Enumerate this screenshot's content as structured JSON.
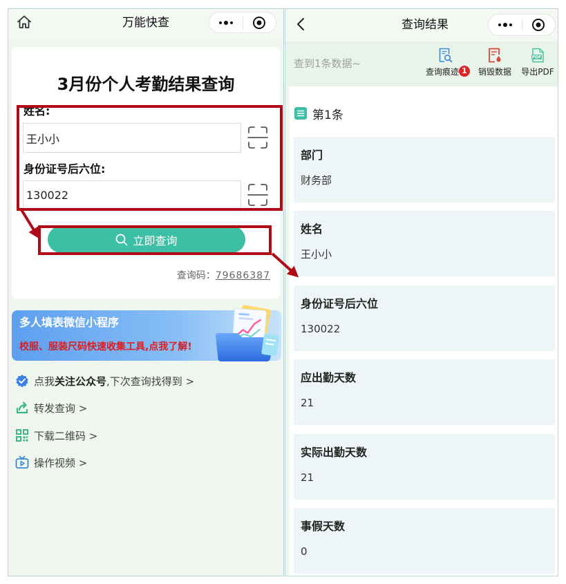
{
  "left_screen": {
    "header": {
      "title": "万能快查"
    },
    "form": {
      "title": "3月份个人考勤结果查询",
      "fields": [
        {
          "label": "姓名:",
          "value": "王小小"
        },
        {
          "label": "身份证号后六位:",
          "value": "130022"
        }
      ],
      "submit_label": "立即查询",
      "query_code_label": "查询码：",
      "query_code": "79686387"
    },
    "banner": {
      "title": "多人填表微信小程序",
      "subtitle": "校服、服装尺码快速收集工具,点我了解!"
    },
    "links": {
      "follow_prefix": "点我",
      "follow_bold": "关注公众号",
      "follow_suffix": ",下次查询找得到 >",
      "forward": "转发查询 >",
      "download_qr": "下载二维码 >",
      "video": "操作视频 >"
    }
  },
  "right_screen": {
    "header": {
      "title": "查询结果"
    },
    "summary": "查到1条数据~",
    "toolbar": [
      {
        "label": "查询痕迹",
        "icon": "search-history-icon",
        "badge": "1"
      },
      {
        "label": "销毁数据",
        "icon": "destroy-data-icon"
      },
      {
        "label": "导出PDF",
        "icon": "export-pdf-icon",
        "icon_text": "PDF"
      }
    ],
    "record": {
      "title": "第1条",
      "fields": [
        {
          "label": "部门",
          "value": "财务部"
        },
        {
          "label": "姓名",
          "value": "王小小"
        },
        {
          "label": "身份证号后六位",
          "value": "130022"
        },
        {
          "label": "应出勤天数",
          "value": "21"
        },
        {
          "label": "实际出勤天数",
          "value": "21"
        },
        {
          "label": "事假天数",
          "value": "0"
        }
      ]
    }
  },
  "colors": {
    "accent": "#3dbfa5",
    "annotation": "#b10a17",
    "field_bg": "#eef5f7",
    "banner_subtitle": "#e21c1c"
  }
}
